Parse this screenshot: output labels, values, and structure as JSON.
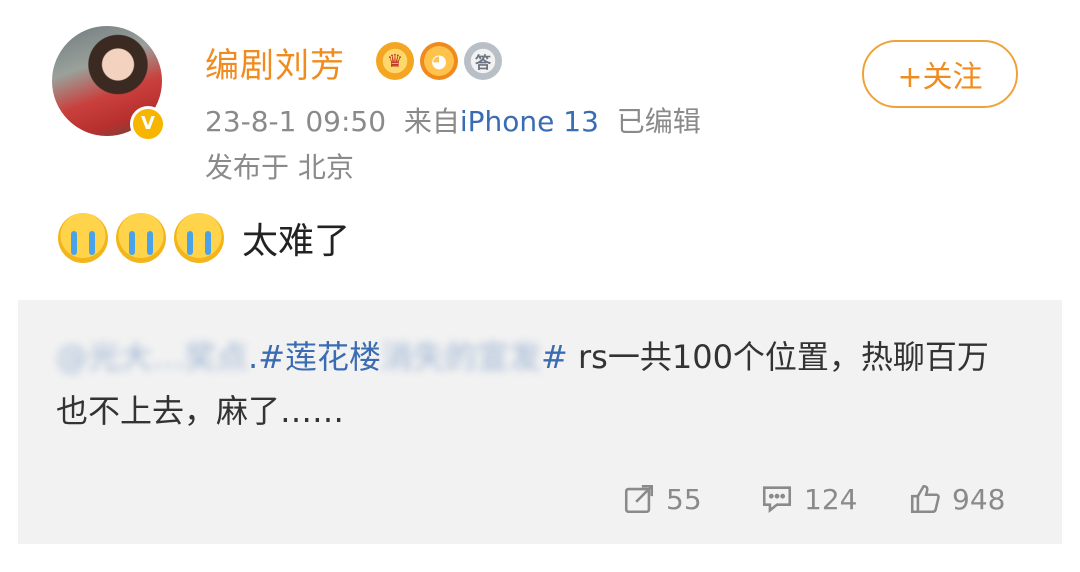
{
  "author": {
    "name": "编剧刘芳",
    "verified_mark": "V",
    "medal_text": "答"
  },
  "meta": {
    "time": "23-8-1 09:50",
    "source_prefix": "来自",
    "device": "iPhone 13",
    "edited": "已编辑",
    "location": "发布于 北京"
  },
  "follow_button": "+关注",
  "post": {
    "emojis": [
      "crying-emoji",
      "crying-emoji",
      "crying-emoji"
    ],
    "text": "太难了"
  },
  "repost": {
    "mention_blurred": "@光大…奖点",
    "hashtag_visible": ".#莲花楼",
    "hashtag_blurred": "消失的宣发",
    "hashtag_end": "#",
    "text": " rs一共100个位置，热聊百万也不上去，麻了……"
  },
  "stats": {
    "reposts": "55",
    "comments": "124",
    "likes": "948"
  },
  "colors": {
    "username": "#f08c1f",
    "link": "#3a6cb3",
    "meta": "#8a8a8a",
    "repost_bg": "#f2f2f2"
  }
}
